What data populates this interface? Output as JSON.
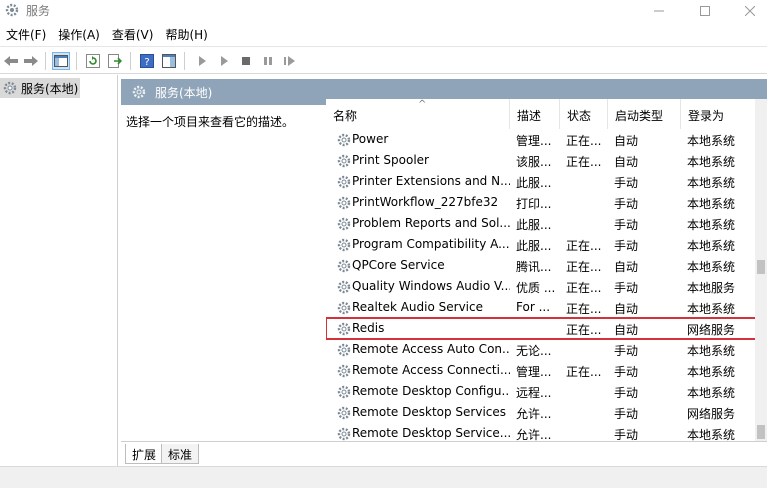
{
  "window": {
    "title": "服务"
  },
  "menu": [
    "文件(F)",
    "操作(A)",
    "查看(V)",
    "帮助(H)"
  ],
  "tree": {
    "root_label": "服务(本地)"
  },
  "pane": {
    "header_label": "服务(本地)",
    "description_prompt": "选择一个项目来查看它的描述。"
  },
  "columns": {
    "name": "名称",
    "description": "描述",
    "status": "状态",
    "startup": "启动类型",
    "logon": "登录为"
  },
  "services": [
    {
      "name": "Power",
      "description": "管理...",
      "status": "正在...",
      "startup": "自动",
      "logon": "本地系统"
    },
    {
      "name": "Print Spooler",
      "description": "该服...",
      "status": "正在...",
      "startup": "自动",
      "logon": "本地系统"
    },
    {
      "name": "Printer Extensions and N...",
      "description": "此服...",
      "status": "",
      "startup": "手动",
      "logon": "本地系统"
    },
    {
      "name": "PrintWorkflow_227bfe32",
      "description": "打印...",
      "status": "",
      "startup": "手动",
      "logon": "本地系统"
    },
    {
      "name": "Problem Reports and Sol...",
      "description": "此服...",
      "status": "",
      "startup": "手动",
      "logon": "本地系统"
    },
    {
      "name": "Program Compatibility A...",
      "description": "此服...",
      "status": "正在...",
      "startup": "手动",
      "logon": "本地系统"
    },
    {
      "name": "QPCore Service",
      "description": "腾讯...",
      "status": "正在...",
      "startup": "自动",
      "logon": "本地系统"
    },
    {
      "name": "Quality Windows Audio V...",
      "description": "优质 ...",
      "status": "正在...",
      "startup": "手动",
      "logon": "本地服务"
    },
    {
      "name": "Realtek Audio Service",
      "description": "For ...",
      "status": "正在...",
      "startup": "自动",
      "logon": "本地系统"
    },
    {
      "name": "Redis",
      "description": "",
      "status": "正在...",
      "startup": "自动",
      "logon": "网络服务"
    },
    {
      "name": "Remote Access Auto Con...",
      "description": "无论...",
      "status": "",
      "startup": "手动",
      "logon": "本地系统"
    },
    {
      "name": "Remote Access Connecti...",
      "description": "管理...",
      "status": "正在...",
      "startup": "手动",
      "logon": "本地系统"
    },
    {
      "name": "Remote Desktop Configu...",
      "description": "远程...",
      "status": "",
      "startup": "手动",
      "logon": "本地系统"
    },
    {
      "name": "Remote Desktop Services",
      "description": "允许...",
      "status": "",
      "startup": "手动",
      "logon": "网络服务"
    },
    {
      "name": "Remote Desktop Service...",
      "description": "允许...",
      "status": "",
      "startup": "手动",
      "logon": "本地系统"
    }
  ],
  "highlighted_service": "Redis",
  "tabs": {
    "extended": "扩展",
    "standard": "标准"
  },
  "colors": {
    "pane_header": "#8fa4b8",
    "highlight_border": "#d2323c"
  }
}
